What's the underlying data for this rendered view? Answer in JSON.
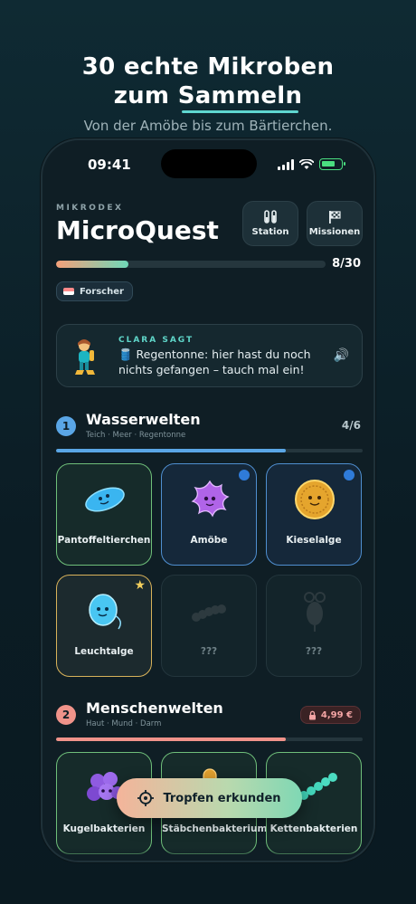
{
  "promo": {
    "headline_line1": "30 echte Mikroben",
    "headline_line2_prefix": "zum ",
    "headline_line2_highlight": "Sammeln",
    "subline": "Von der Amöbe bis zum Bärtierchen."
  },
  "status_bar": {
    "time": "09:41"
  },
  "header": {
    "eyebrow": "MIKRODEX",
    "title": "MicroQuest",
    "buttons": [
      {
        "label": "Station",
        "icon": "test-tubes-icon"
      },
      {
        "label": "Missionen",
        "icon": "flag-icon"
      }
    ],
    "progress_text": "8/30",
    "progress_fraction": 0.267,
    "rank": "Forscher"
  },
  "clara": {
    "title": "CLARA SAGT",
    "message": "🛢️ Regentonne: hier hast du noch nichts gefangen – tauch mal ein!"
  },
  "sections": [
    {
      "number": "1",
      "title": "Wasserwelten",
      "subtitle": "Teich · Meer · Regentonne",
      "count": "4/6",
      "progress_fraction": 0.75,
      "cards": [
        {
          "name": "Pantoffeltierchen",
          "state": "caught"
        },
        {
          "name": "Amöbe",
          "state": "new"
        },
        {
          "name": "Kieselalge",
          "state": "new"
        },
        {
          "name": "Leuchtalge",
          "state": "rare"
        },
        {
          "name": "???",
          "state": "locked"
        },
        {
          "name": "???",
          "state": "locked"
        }
      ]
    },
    {
      "number": "2",
      "title": "Menschenwelten",
      "subtitle": "Haut · Mund · Darm",
      "price": "4,99 €",
      "progress_fraction": 0.75,
      "cards": [
        {
          "name": "Kugelbakterien",
          "state": "caught"
        },
        {
          "name": "Stäbchenbakterium",
          "state": "caught"
        },
        {
          "name": "Kettenbakterien",
          "state": "caught"
        }
      ]
    }
  ],
  "fab": {
    "label": "Tropfen erkunden"
  },
  "colors": {
    "accent_teal": "#5fd6c9",
    "new_dot": "#2f7bd9",
    "gold": "#d8b25a",
    "lock_red": "#f3a4a4"
  }
}
